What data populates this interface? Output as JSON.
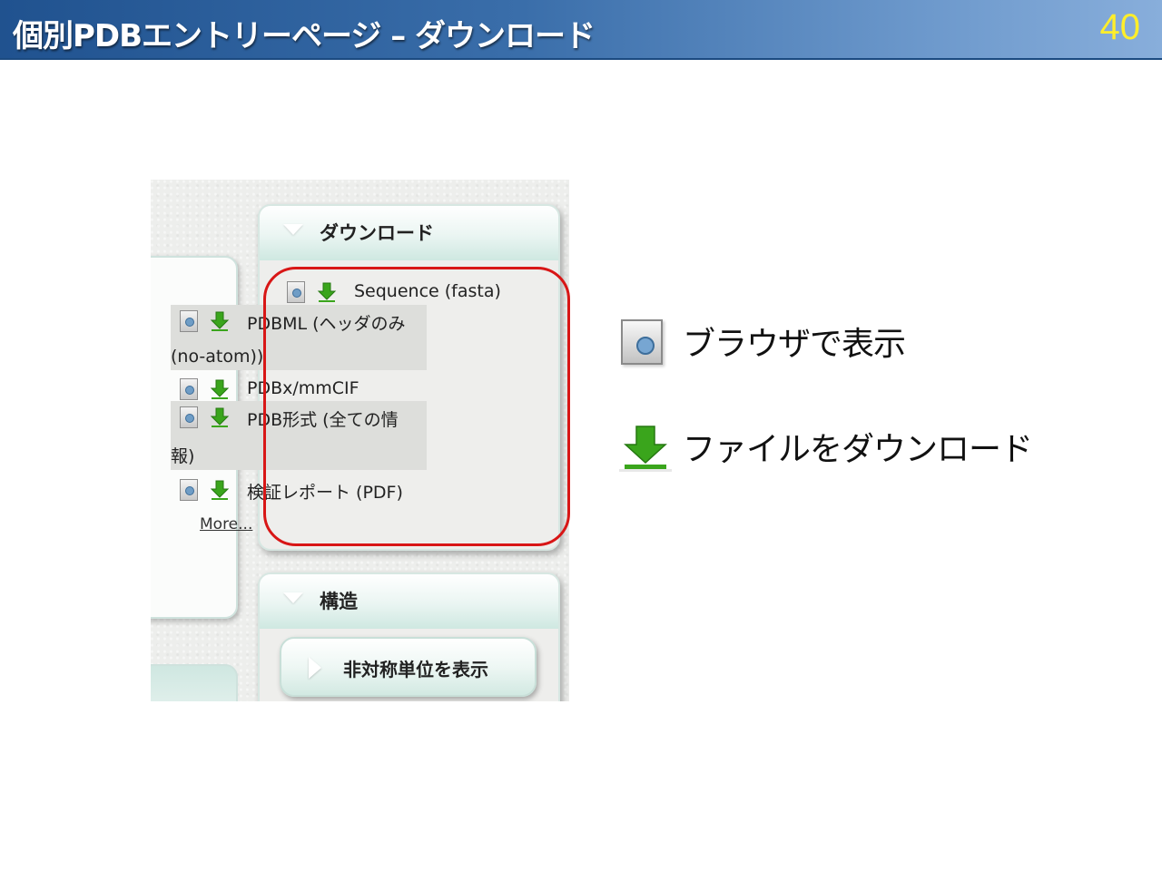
{
  "slide": {
    "title": "個別PDBエントリーページ – ダウンロード",
    "page_number": "40"
  },
  "screenshot": {
    "download_box": {
      "title": "ダウンロード",
      "items": [
        {
          "lines": [
            "Sequence (fasta)"
          ],
          "icon_view": "view-in-browser-icon",
          "icon_download": "download-arrow-icon"
        },
        {
          "lines": [
            "PDBML (ヘッダのみ",
            "(no-atom))"
          ],
          "icon_view": "view-in-browser-icon",
          "icon_download": "download-arrow-icon"
        },
        {
          "lines": [
            "PDBx/mmCIF"
          ],
          "icon_view": "view-in-browser-icon",
          "icon_download": "download-arrow-icon"
        },
        {
          "lines": [
            "PDB形式 (全ての情",
            "報)"
          ],
          "icon_view": "view-in-browser-icon",
          "icon_download": "download-arrow-icon"
        },
        {
          "lines": [
            "検証レポート (PDF)"
          ],
          "icon_view": "view-in-browser-icon",
          "icon_download": "download-arrow-icon"
        }
      ],
      "more_link": "More..."
    },
    "structure_box": {
      "title": "構造",
      "button_label": "非対称単位を表示"
    }
  },
  "legend": {
    "view_label": "ブラウザで表示",
    "download_label": "ファイルをダウンロード"
  },
  "colors": {
    "header_dark": "#20528f",
    "header_light": "#88aedb",
    "page_number": "#ffee2a",
    "highlight_ring": "#d81616",
    "download_green": "#3aa51c"
  }
}
